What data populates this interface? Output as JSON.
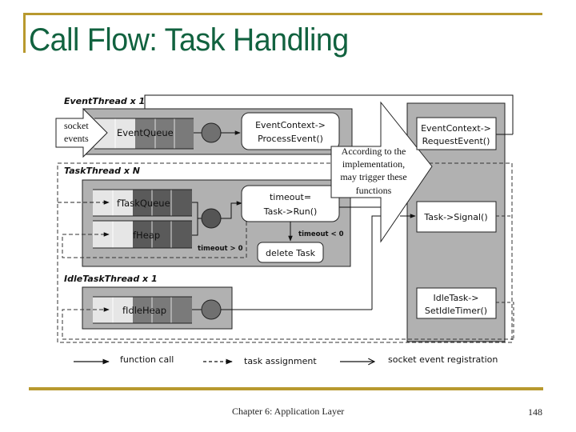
{
  "slide": {
    "title": "Call Flow: Task Handling",
    "footer": "Chapter 6: Application Layer",
    "page_number": "148",
    "accent_color": "#b8992e",
    "title_color": "#11623f"
  },
  "diagram": {
    "threads": {
      "event_thread": "EventThread x 1",
      "task_thread": "TaskThread x N",
      "idle_task_thread": "IdleTaskThread x 1"
    },
    "socket_events_line1": "socket",
    "socket_events_line2": "events",
    "queues": {
      "event_queue": "EventQueue",
      "task_queue": "fTaskQueue",
      "heap": "fHeap",
      "idle_heap": "fIdleHeap"
    },
    "boxes": {
      "process_event_line1": "EventContext->",
      "process_event_line2": "ProcessEvent()",
      "run_line1": "timeout=",
      "run_line2": "Task->Run()",
      "delete_task": "delete Task",
      "request_event_line1": "EventContext->",
      "request_event_line2": "RequestEvent()",
      "signal": "Task->Signal()",
      "idle_timer_line1": "IdleTask->",
      "idle_timer_line2": "SetIdleTimer()"
    },
    "conditions": {
      "timeout_lt": "timeout < 0",
      "timeout_gt": "timeout > 0"
    },
    "callout": {
      "line1": "According to the",
      "line2": "implementation,",
      "line3": "may trigger these",
      "line4": "functions"
    },
    "legend": {
      "function_call": "function call",
      "task_assignment": "task assignment",
      "socket_event_registration": "socket event registration"
    }
  }
}
